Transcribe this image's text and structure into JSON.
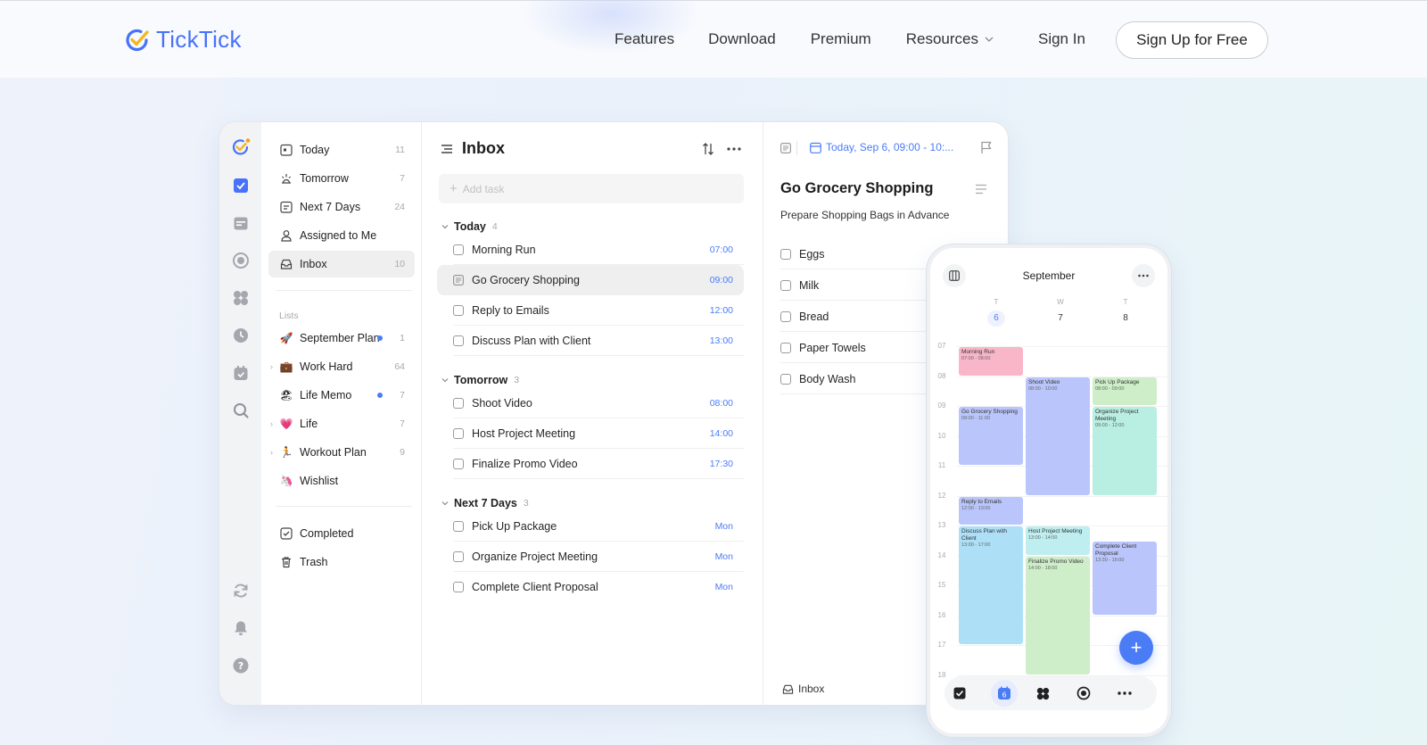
{
  "brand": {
    "name": "TickTick",
    "accent": "#4772fa"
  },
  "nav": {
    "items": [
      "Features",
      "Download",
      "Premium",
      "Resources",
      "Sign In"
    ],
    "cta": "Sign Up for Free"
  },
  "app": {
    "rail_icons": [
      "avatar-icon",
      "checkbox-icon",
      "calendar-icon",
      "focus-icon",
      "matrix-icon",
      "clock-icon",
      "habit-icon",
      "search-icon",
      "sync-icon",
      "bell-icon",
      "help-icon"
    ],
    "sidebar": {
      "smart": [
        {
          "label": "Today",
          "count": "11",
          "icon": "today-icon"
        },
        {
          "label": "Tomorrow",
          "count": "7",
          "icon": "tomorrow-icon"
        },
        {
          "label": "Next 7 Days",
          "count": "24",
          "icon": "week-icon"
        },
        {
          "label": "Assigned to Me",
          "count": "",
          "icon": "person-icon"
        },
        {
          "label": "Inbox",
          "count": "10",
          "icon": "inbox-icon"
        }
      ],
      "lists_heading": "Lists",
      "lists": [
        {
          "emoji": "🚀",
          "label": "September Plan",
          "count": "1",
          "dot": true,
          "caret": false
        },
        {
          "emoji": "💼",
          "label": "Work Hard",
          "count": "64",
          "dot": false,
          "caret": true
        },
        {
          "emoji": "🏖",
          "label": "Life Memo",
          "count": "7",
          "dot": true,
          "caret": false
        },
        {
          "emoji": "💗",
          "label": "Life",
          "count": "7",
          "dot": false,
          "caret": true
        },
        {
          "emoji": "🏃",
          "label": "Workout Plan",
          "count": "9",
          "dot": false,
          "caret": true
        },
        {
          "emoji": "🦄",
          "label": "Wishlist",
          "count": "",
          "dot": false,
          "caret": false
        }
      ],
      "bottom": [
        {
          "label": "Completed",
          "icon": "completed-icon"
        },
        {
          "label": "Trash",
          "icon": "trash-icon"
        }
      ]
    },
    "task_list": {
      "title": "Inbox",
      "add_placeholder": "Add task",
      "groups": [
        {
          "name": "Today",
          "count": "4",
          "tasks": [
            {
              "title": "Morning Run",
              "time": "07:00"
            },
            {
              "title": "Go Grocery Shopping",
              "time": "09:00",
              "selected": true
            },
            {
              "title": "Reply to Emails",
              "time": "12:00"
            },
            {
              "title": "Discuss Plan with Client",
              "time": "13:00"
            }
          ]
        },
        {
          "name": "Tomorrow",
          "count": "3",
          "tasks": [
            {
              "title": "Shoot Video",
              "time": "08:00"
            },
            {
              "title": "Host Project Meeting",
              "time": "14:00"
            },
            {
              "title": "Finalize Promo Video",
              "time": "17:30"
            }
          ]
        },
        {
          "name": "Next 7 Days",
          "count": "3",
          "tasks": [
            {
              "title": "Pick Up Package",
              "time": "Mon"
            },
            {
              "title": "Organize Project Meeting",
              "time": "Mon"
            },
            {
              "title": "Complete Client Proposal",
              "time": "Mon"
            }
          ]
        }
      ]
    },
    "detail": {
      "date": "Today, Sep 6, 09:00 - 10:...",
      "title": "Go Grocery Shopping",
      "subtitle": "Prepare Shopping Bags in Advance",
      "checklist": [
        "Eggs",
        "Milk",
        "Bread",
        "Paper Towels",
        "Body Wash"
      ],
      "footer_list": "Inbox"
    }
  },
  "phone": {
    "month": "September",
    "days": [
      {
        "dow": "T",
        "num": "6",
        "today": true
      },
      {
        "dow": "W",
        "num": "7",
        "today": false
      },
      {
        "dow": "T",
        "num": "8",
        "today": false
      }
    ],
    "hours": [
      "07",
      "08",
      "09",
      "10",
      "11",
      "12",
      "13",
      "14",
      "15",
      "16",
      "17",
      "18"
    ],
    "events": [
      {
        "title": "Morning Run",
        "time": "07:00 - 08:00",
        "day": 0,
        "start": 7,
        "end": 8,
        "color": "#f9b6c9"
      },
      {
        "title": "Go Grocery Shopping",
        "time": "09:00 - 11:00",
        "day": 0,
        "start": 9,
        "end": 11,
        "color": "#bac6fb"
      },
      {
        "title": "Reply to Emails",
        "time": "12:00 - 13:00",
        "day": 0,
        "start": 12,
        "end": 13,
        "color": "#bac6fb"
      },
      {
        "title": "Discuss Plan with Client",
        "time": "13:00 - 17:00",
        "day": 0,
        "start": 13,
        "end": 17,
        "color": "#ade0f7"
      },
      {
        "title": "Shoot Video",
        "time": "08:00 - 10:00",
        "day": 1,
        "start": 8,
        "end": 12,
        "color": "#bac6fb"
      },
      {
        "title": "Host Project Meeting",
        "time": "13:00 - 14:00",
        "day": 1,
        "start": 13,
        "end": 14,
        "color": "#bfeef0"
      },
      {
        "title": "Finalize Promo Video",
        "time": "14:00 - 18:00",
        "day": 1,
        "start": 14,
        "end": 18,
        "color": "#cdeec8"
      },
      {
        "title": "Pick Up Package",
        "time": "08:00 - 09:00",
        "day": 2,
        "start": 8,
        "end": 9,
        "color": "#cdeec8"
      },
      {
        "title": "Organize Project Meeting",
        "time": "09:00 - 12:00",
        "day": 2,
        "start": 9,
        "end": 12,
        "color": "#b9eee2"
      },
      {
        "title": "Complete Client Proposal",
        "time": "13:30 - 16:00",
        "day": 2,
        "start": 13.5,
        "end": 16,
        "color": "#bac6fb"
      }
    ],
    "tabs": [
      "task-tab-icon",
      "calendar-tab-icon",
      "matrix-tab-icon",
      "focus-tab-icon",
      "more-tab-icon"
    ],
    "calendar_tab_label": "6"
  }
}
